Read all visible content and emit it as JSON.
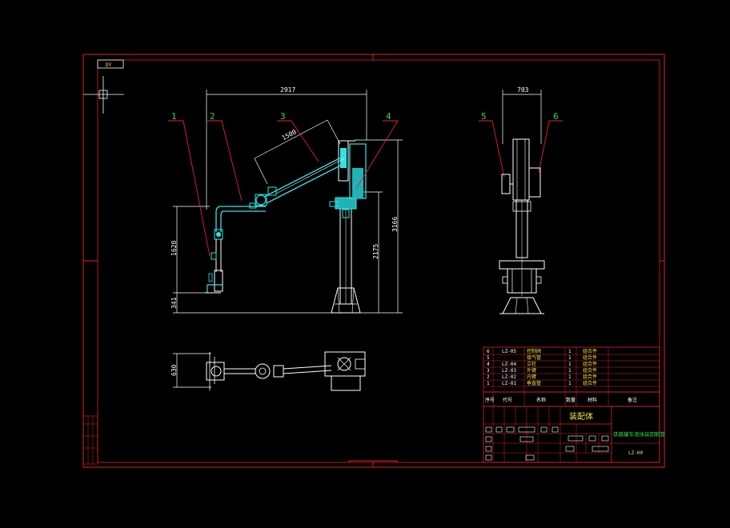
{
  "drawing": {
    "corner_tag": "DY",
    "dimensions": {
      "reach_width": "2917",
      "arm_length": "1500",
      "total_height": "3166",
      "riser_height": "1620",
      "base_height": "341",
      "column_height": "2175",
      "side_width": "703",
      "plan_width": "630"
    },
    "balloons": [
      "1",
      "2",
      "3",
      "4",
      "5",
      "6"
    ]
  },
  "title_block": {
    "parts": [
      {
        "seq": "6",
        "code": "LZ-05",
        "name": "控制阀",
        "qty": "1",
        "material": "组合件",
        "note": ""
      },
      {
        "seq": "5",
        "code": "",
        "name": "接气管",
        "qty": "1",
        "material": "组合件",
        "note": ""
      },
      {
        "seq": "4",
        "code": "LZ-04",
        "name": "立柱",
        "qty": "1",
        "material": "组合件",
        "note": ""
      },
      {
        "seq": "3",
        "code": "LZ-03",
        "name": "外臂",
        "qty": "1",
        "material": "组合件",
        "note": ""
      },
      {
        "seq": "2",
        "code": "LZ-02",
        "name": "内臂",
        "qty": "1",
        "material": "组合件",
        "note": ""
      },
      {
        "seq": "1",
        "code": "LZ-01",
        "name": "垂直管",
        "qty": "1",
        "material": "组合件",
        "note": ""
      }
    ],
    "header": [
      "序号",
      "代号",
      "名称",
      "数量",
      "材料",
      "备注"
    ],
    "drawing_title": "装配体",
    "subtitle": "铁路罐车液体装卸鹤管",
    "drawing_number": "LZ-00"
  }
}
